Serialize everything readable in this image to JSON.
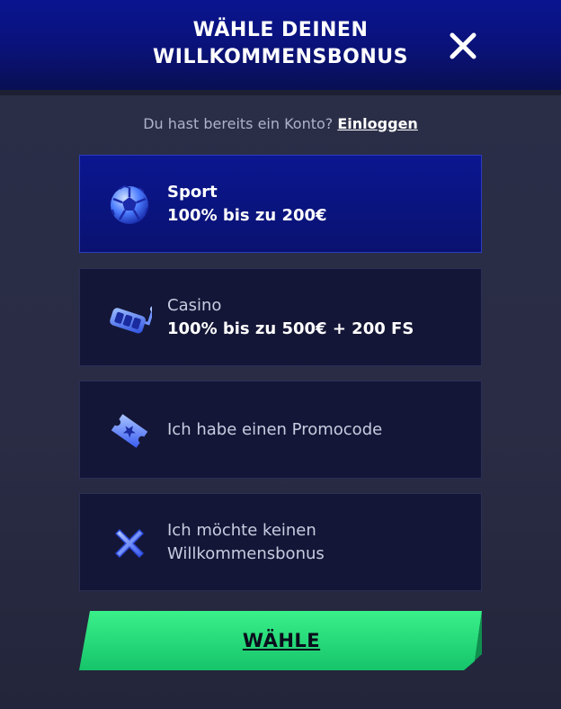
{
  "header": {
    "title_line1": "WÄHLE DEINEN",
    "title_line2": "WILLKOMMENSBONUS",
    "close_icon": "close-icon"
  },
  "login": {
    "prompt": "Du hast bereits ein Konto?",
    "link": "Einloggen"
  },
  "options": [
    {
      "icon": "soccer-ball-icon",
      "line1": "Sport",
      "line2": "100% bis zu 200€",
      "selected": true
    },
    {
      "icon": "slot-machine-icon",
      "line1": "Casino",
      "line2": "100% bis zu 500€ + 200 FS",
      "selected": false
    },
    {
      "icon": "ticket-icon",
      "line1": "Ich habe einen Promocode",
      "selected": false
    },
    {
      "icon": "cross-icon",
      "line1": "Ich möchte keinen",
      "line1b": "Willkommensbonus",
      "selected": false
    }
  ],
  "submit": {
    "label": "WÄHLE"
  },
  "colors": {
    "header_bg": "#0a1490",
    "panel_bg": "#2a2d45",
    "option_bg": "#141637",
    "selected_bg": "#0b1690",
    "button_green": "#2fe07f"
  }
}
